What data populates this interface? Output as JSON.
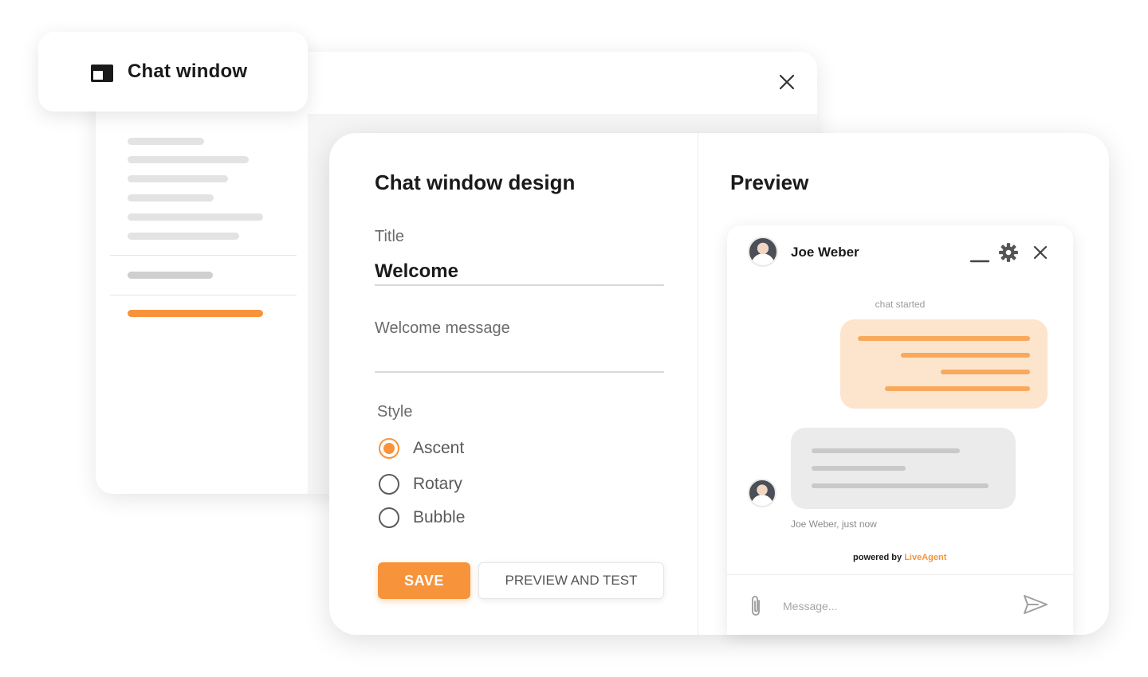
{
  "tab": {
    "label": "Chat window",
    "icon": "window-icon"
  },
  "background_window": {
    "close_icon": "close-icon"
  },
  "design": {
    "heading": "Chat window design",
    "title_label": "Title",
    "title_value": "Welcome",
    "welcome_label": "Welcome message",
    "welcome_value": "",
    "style_label": "Style",
    "styles": [
      {
        "label": "Ascent",
        "checked": true
      },
      {
        "label": "Rotary",
        "checked": false
      },
      {
        "label": "Bubble",
        "checked": false
      }
    ],
    "save_label": "SAVE",
    "preview_label": "PREVIEW AND TEST"
  },
  "preview": {
    "heading": "Preview",
    "agent_name": "Joe Weber",
    "header_icons": [
      "minimize-icon",
      "gear-icon",
      "close-icon"
    ],
    "chat_started": "chat started",
    "meta": "Joe Weber, just now",
    "powered_prefix": "powered by",
    "powered_brand": "LiveAgent",
    "message_placeholder": "Message...",
    "composer_icons": [
      "paperclip-icon",
      "send-icon"
    ]
  },
  "colors": {
    "accent": "#f7943b",
    "outgoing_bubble": "#fde4cd",
    "incoming_bubble": "#ebebeb",
    "skeleton": "#e3e3e3"
  }
}
